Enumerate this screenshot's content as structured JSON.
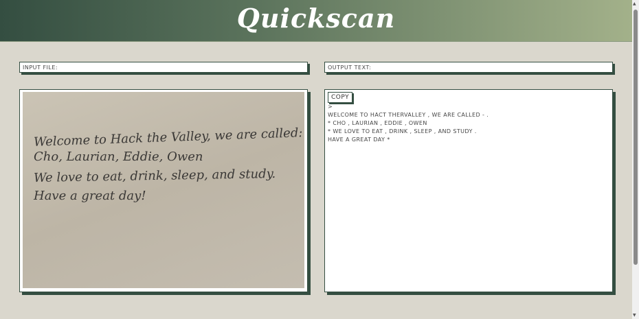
{
  "header": {
    "title": "Quickscan"
  },
  "input_file": {
    "label": "INPUT FILE:"
  },
  "output_text": {
    "label": "OUTPUT TEXT:"
  },
  "image_panel": {
    "lines": [
      "Welcome to Hack the Valley, we are called:",
      "Cho, Laurian, Eddie, Owen",
      "We love to eat, drink, sleep, and study.",
      "Have a great day!"
    ]
  },
  "output_panel": {
    "copy_label": "COPY",
    "text": ">\nWELCOME TO HACT THERVALLEY , WE ARE CALLED - .\n* CHO , LAURIAN , EDDIE , OWEN\n* WE LOVE TO EAT , DRINK , SLEEP , AND STUDY .\nHAVE A GREAT DAY *"
  },
  "colors": {
    "primary": "#344e41",
    "accent": "#a3b18a",
    "background": "#dad7cd"
  }
}
